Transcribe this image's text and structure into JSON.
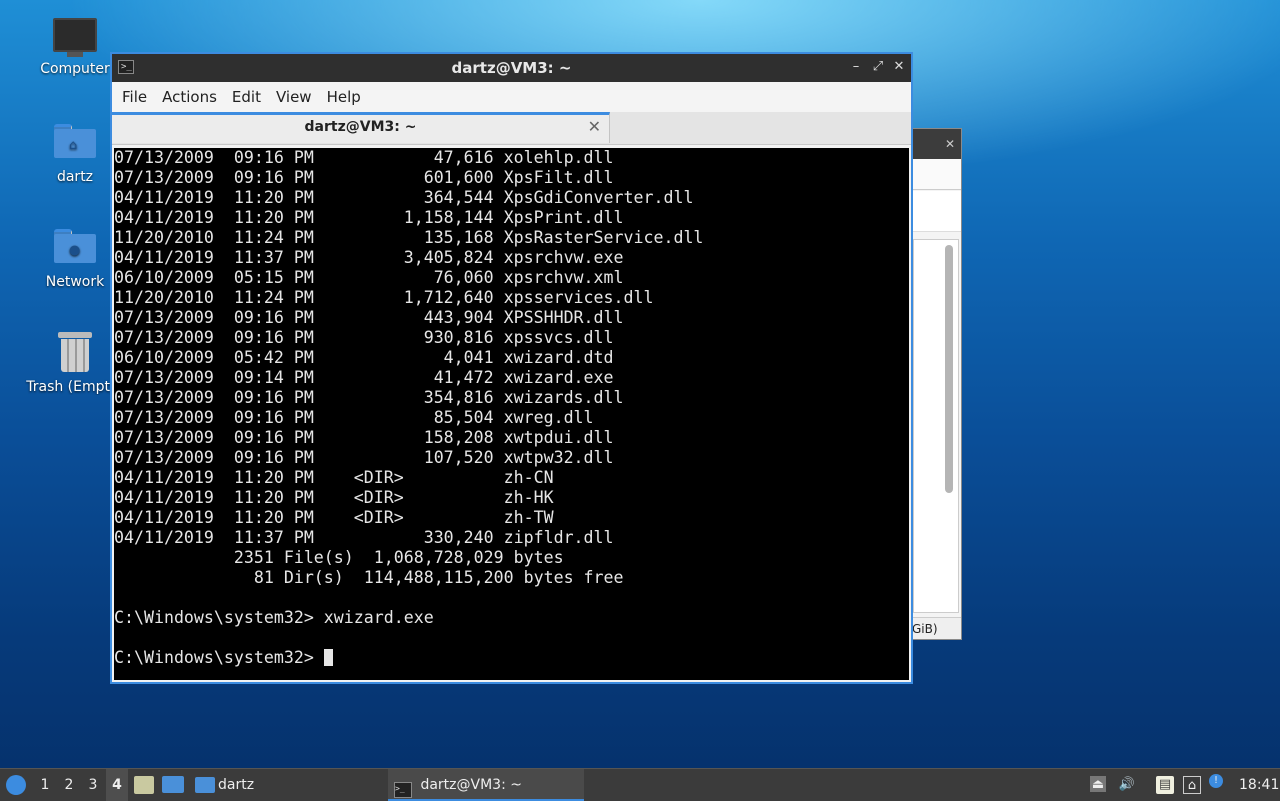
{
  "desktop": {
    "icons": [
      {
        "label": "Computer"
      },
      {
        "label": "dartz"
      },
      {
        "label": "Network"
      },
      {
        "label": "Trash (Empty)"
      }
    ]
  },
  "background_window": {
    "status_text": "GiB)"
  },
  "terminal": {
    "title": "dartz@VM3: ~",
    "menu": [
      "File",
      "Actions",
      "Edit",
      "View",
      "Help"
    ],
    "tab_title": "dartz@VM3: ~",
    "lines": [
      "07/13/2009  09:16 PM            47,616 xolehlp.dll",
      "07/13/2009  09:16 PM           601,600 XpsFilt.dll",
      "04/11/2019  11:20 PM           364,544 XpsGdiConverter.dll",
      "04/11/2019  11:20 PM         1,158,144 XpsPrint.dll",
      "11/20/2010  11:24 PM           135,168 XpsRasterService.dll",
      "04/11/2019  11:37 PM         3,405,824 xpsrchvw.exe",
      "06/10/2009  05:15 PM            76,060 xpsrchvw.xml",
      "11/20/2010  11:24 PM         1,712,640 xpsservices.dll",
      "07/13/2009  09:16 PM           443,904 XPSSHHDR.dll",
      "07/13/2009  09:16 PM           930,816 xpssvcs.dll",
      "06/10/2009  05:42 PM             4,041 xwizard.dtd",
      "07/13/2009  09:14 PM            41,472 xwizard.exe",
      "07/13/2009  09:16 PM           354,816 xwizards.dll",
      "07/13/2009  09:16 PM            85,504 xwreg.dll",
      "07/13/2009  09:16 PM           158,208 xwtpdui.dll",
      "07/13/2009  09:16 PM           107,520 xwtpw32.dll",
      "04/11/2019  11:20 PM    <DIR>          zh-CN",
      "04/11/2019  11:20 PM    <DIR>          zh-HK",
      "04/11/2019  11:20 PM    <DIR>          zh-TW",
      "04/11/2019  11:37 PM           330,240 zipfldr.dll",
      "            2351 File(s)  1,068,728,029 bytes",
      "              81 Dir(s)  114,488,115,200 bytes free",
      "",
      "C:\\Windows\\system32> xwizard.exe",
      ""
    ],
    "prompt": "C:\\Windows\\system32> "
  },
  "taskbar": {
    "workspaces": [
      "1",
      "2",
      "3",
      "4"
    ],
    "active_workspace": "4",
    "launcher_folder_label": "dartz",
    "task_label": "dartz@VM3: ~",
    "clock": "18:41"
  },
  "colors": {
    "accent": "#3c8ce0",
    "terminal_bg": "#000000",
    "terminal_fg": "#e6e6e6"
  }
}
